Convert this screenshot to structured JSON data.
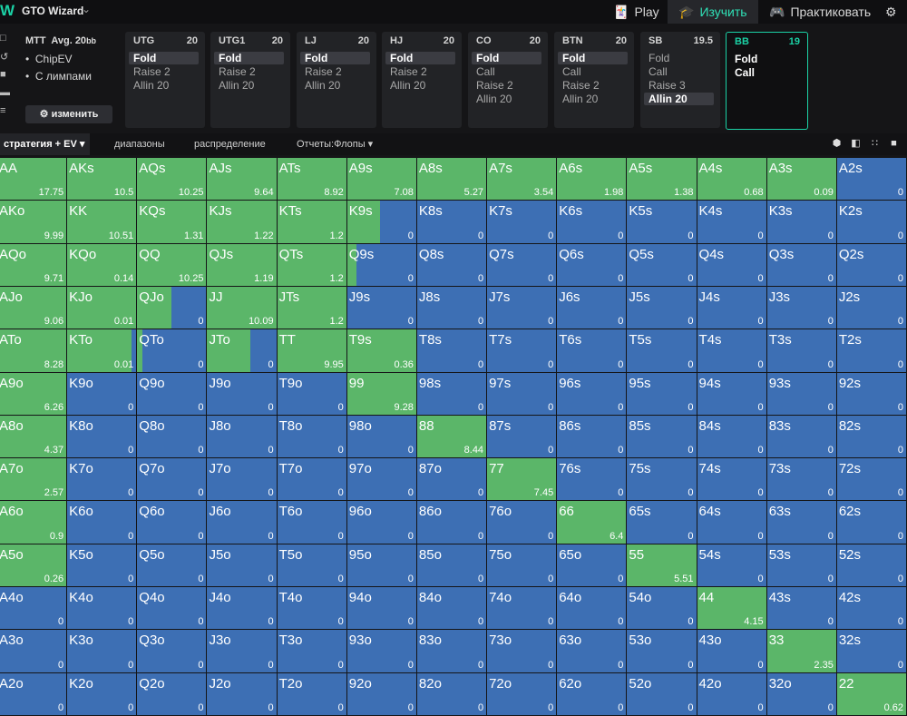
{
  "app": {
    "title": "GTO Wizard"
  },
  "nav": {
    "play": "Play",
    "study": "Изучить",
    "practice": "Практиковать"
  },
  "info": {
    "format": "MTT",
    "avg": "Avg. 20",
    "avg_unit": "bb",
    "option1": "ChipEV",
    "option2": "С лимпами",
    "change_button": "изменить"
  },
  "positions": [
    {
      "name": "UTG",
      "stack": "20",
      "actions": [
        "Fold",
        "Raise 2",
        "Allin 20"
      ],
      "selected": 0
    },
    {
      "name": "UTG1",
      "stack": "20",
      "actions": [
        "Fold",
        "Raise 2",
        "Allin 20"
      ],
      "selected": 0
    },
    {
      "name": "LJ",
      "stack": "20",
      "actions": [
        "Fold",
        "Raise 2",
        "Allin 20"
      ],
      "selected": 0
    },
    {
      "name": "HJ",
      "stack": "20",
      "actions": [
        "Fold",
        "Raise 2",
        "Allin 20"
      ],
      "selected": 0
    },
    {
      "name": "CO",
      "stack": "20",
      "actions": [
        "Fold",
        "Call",
        "Raise 2",
        "Allin 20"
      ],
      "selected": 0
    },
    {
      "name": "BTN",
      "stack": "20",
      "actions": [
        "Fold",
        "Call",
        "Raise 2",
        "Allin 20"
      ],
      "selected": 0
    },
    {
      "name": "SB",
      "stack": "19.5",
      "actions": [
        "Fold",
        "Call",
        "Raise 3",
        "Allin 20"
      ],
      "selected": 3
    },
    {
      "name": "BB",
      "stack": "19",
      "actions": [
        "Fold",
        "Call"
      ],
      "selected": -1,
      "active": true
    }
  ],
  "tabs": [
    "стратегия + EV",
    "диапазоны",
    "распределение",
    "Отчеты:Флопы"
  ],
  "colors": {
    "call": "#5bb669",
    "fold": "#3d6fb4",
    "accent": "#1bd1a5"
  },
  "matrix": [
    [
      [
        "AA",
        1,
        "17.75"
      ],
      [
        "AKs",
        1,
        "10.5"
      ],
      [
        "AQs",
        1,
        "10.25"
      ],
      [
        "AJs",
        1,
        "9.64"
      ],
      [
        "ATs",
        1,
        "8.92"
      ],
      [
        "A9s",
        1,
        "7.08"
      ],
      [
        "A8s",
        1,
        "5.27"
      ],
      [
        "A7s",
        1,
        "3.54"
      ],
      [
        "A6s",
        1,
        "1.98"
      ],
      [
        "A5s",
        1,
        "1.38"
      ],
      [
        "A4s",
        1,
        "0.68"
      ],
      [
        "A3s",
        1,
        "0.09"
      ],
      [
        "A2s",
        0,
        "0"
      ]
    ],
    [
      [
        "AKo",
        1,
        "9.99"
      ],
      [
        "KK",
        1,
        "10.51"
      ],
      [
        "KQs",
        1,
        "1.31"
      ],
      [
        "KJs",
        1,
        "1.22"
      ],
      [
        "KTs",
        1,
        "1.2"
      ],
      [
        "K9s",
        0.48,
        "0"
      ],
      [
        "K8s",
        0,
        "0"
      ],
      [
        "K7s",
        0,
        "0"
      ],
      [
        "K6s",
        0,
        "0"
      ],
      [
        "K5s",
        0,
        "0"
      ],
      [
        "K4s",
        0,
        "0"
      ],
      [
        "K3s",
        0,
        "0"
      ],
      [
        "K2s",
        0,
        "0"
      ]
    ],
    [
      [
        "AQo",
        1,
        "9.71"
      ],
      [
        "KQo",
        1,
        "0.14"
      ],
      [
        "QQ",
        1,
        "10.25"
      ],
      [
        "QJs",
        1,
        "1.19"
      ],
      [
        "QTs",
        1,
        "1.2"
      ],
      [
        "Q9s",
        0.13,
        "0"
      ],
      [
        "Q8s",
        0,
        "0"
      ],
      [
        "Q7s",
        0,
        "0"
      ],
      [
        "Q6s",
        0,
        "0"
      ],
      [
        "Q5s",
        0,
        "0"
      ],
      [
        "Q4s",
        0,
        "0"
      ],
      [
        "Q3s",
        0,
        "0"
      ],
      [
        "Q2s",
        0,
        "0"
      ]
    ],
    [
      [
        "AJo",
        1,
        "9.06"
      ],
      [
        "KJo",
        1,
        "0.01"
      ],
      [
        "QJo",
        0.49,
        "0"
      ],
      [
        "JJ",
        1,
        "10.09"
      ],
      [
        "JTs",
        1,
        "1.2"
      ],
      [
        "J9s",
        0,
        "0"
      ],
      [
        "J8s",
        0,
        "0"
      ],
      [
        "J7s",
        0,
        "0"
      ],
      [
        "J6s",
        0,
        "0"
      ],
      [
        "J5s",
        0,
        "0"
      ],
      [
        "J4s",
        0,
        "0"
      ],
      [
        "J3s",
        0,
        "0"
      ],
      [
        "J2s",
        0,
        "0"
      ]
    ],
    [
      [
        "ATo",
        1,
        "8.28"
      ],
      [
        "KTo",
        0.93,
        "0.01"
      ],
      [
        "QTo",
        0.07,
        "0"
      ],
      [
        "JTo",
        0.62,
        "0"
      ],
      [
        "TT",
        1,
        "9.95"
      ],
      [
        "T9s",
        1,
        "0.36"
      ],
      [
        "T8s",
        0,
        "0"
      ],
      [
        "T7s",
        0,
        "0"
      ],
      [
        "T6s",
        0,
        "0"
      ],
      [
        "T5s",
        0,
        "0"
      ],
      [
        "T4s",
        0,
        "0"
      ],
      [
        "T3s",
        0,
        "0"
      ],
      [
        "T2s",
        0,
        "0"
      ]
    ],
    [
      [
        "A9o",
        1,
        "6.26"
      ],
      [
        "K9o",
        0,
        "0"
      ],
      [
        "Q9o",
        0,
        "0"
      ],
      [
        "J9o",
        0,
        "0"
      ],
      [
        "T9o",
        0,
        "0"
      ],
      [
        "99",
        1,
        "9.28"
      ],
      [
        "98s",
        0,
        "0"
      ],
      [
        "97s",
        0,
        "0"
      ],
      [
        "96s",
        0,
        "0"
      ],
      [
        "95s",
        0,
        "0"
      ],
      [
        "94s",
        0,
        "0"
      ],
      [
        "93s",
        0,
        "0"
      ],
      [
        "92s",
        0,
        "0"
      ]
    ],
    [
      [
        "A8o",
        1,
        "4.37"
      ],
      [
        "K8o",
        0,
        "0"
      ],
      [
        "Q8o",
        0,
        "0"
      ],
      [
        "J8o",
        0,
        "0"
      ],
      [
        "T8o",
        0,
        "0"
      ],
      [
        "98o",
        0,
        "0"
      ],
      [
        "88",
        1,
        "8.44"
      ],
      [
        "87s",
        0,
        "0"
      ],
      [
        "86s",
        0,
        "0"
      ],
      [
        "85s",
        0,
        "0"
      ],
      [
        "84s",
        0,
        "0"
      ],
      [
        "83s",
        0,
        "0"
      ],
      [
        "82s",
        0,
        "0"
      ]
    ],
    [
      [
        "A7o",
        1,
        "2.57"
      ],
      [
        "K7o",
        0,
        "0"
      ],
      [
        "Q7o",
        0,
        "0"
      ],
      [
        "J7o",
        0,
        "0"
      ],
      [
        "T7o",
        0,
        "0"
      ],
      [
        "97o",
        0,
        "0"
      ],
      [
        "87o",
        0,
        "0"
      ],
      [
        "77",
        1,
        "7.45"
      ],
      [
        "76s",
        0,
        "0"
      ],
      [
        "75s",
        0,
        "0"
      ],
      [
        "74s",
        0,
        "0"
      ],
      [
        "73s",
        0,
        "0"
      ],
      [
        "72s",
        0,
        "0"
      ]
    ],
    [
      [
        "A6o",
        1,
        "0.9"
      ],
      [
        "K6o",
        0,
        "0"
      ],
      [
        "Q6o",
        0,
        "0"
      ],
      [
        "J6o",
        0,
        "0"
      ],
      [
        "T6o",
        0,
        "0"
      ],
      [
        "96o",
        0,
        "0"
      ],
      [
        "86o",
        0,
        "0"
      ],
      [
        "76o",
        0,
        "0"
      ],
      [
        "66",
        1,
        "6.4"
      ],
      [
        "65s",
        0,
        "0"
      ],
      [
        "64s",
        0,
        "0"
      ],
      [
        "63s",
        0,
        "0"
      ],
      [
        "62s",
        0,
        "0"
      ]
    ],
    [
      [
        "A5o",
        1,
        "0.26"
      ],
      [
        "K5o",
        0,
        "0"
      ],
      [
        "Q5o",
        0,
        "0"
      ],
      [
        "J5o",
        0,
        "0"
      ],
      [
        "T5o",
        0,
        "0"
      ],
      [
        "95o",
        0,
        "0"
      ],
      [
        "85o",
        0,
        "0"
      ],
      [
        "75o",
        0,
        "0"
      ],
      [
        "65o",
        0,
        "0"
      ],
      [
        "55",
        1,
        "5.51"
      ],
      [
        "54s",
        0,
        "0"
      ],
      [
        "53s",
        0,
        "0"
      ],
      [
        "52s",
        0,
        "0"
      ]
    ],
    [
      [
        "A4o",
        0,
        "0"
      ],
      [
        "K4o",
        0,
        "0"
      ],
      [
        "Q4o",
        0,
        "0"
      ],
      [
        "J4o",
        0,
        "0"
      ],
      [
        "T4o",
        0,
        "0"
      ],
      [
        "94o",
        0,
        "0"
      ],
      [
        "84o",
        0,
        "0"
      ],
      [
        "74o",
        0,
        "0"
      ],
      [
        "64o",
        0,
        "0"
      ],
      [
        "54o",
        0,
        "0"
      ],
      [
        "44",
        1,
        "4.15"
      ],
      [
        "43s",
        0,
        "0"
      ],
      [
        "42s",
        0,
        "0"
      ]
    ],
    [
      [
        "A3o",
        0,
        "0"
      ],
      [
        "K3o",
        0,
        "0"
      ],
      [
        "Q3o",
        0,
        "0"
      ],
      [
        "J3o",
        0,
        "0"
      ],
      [
        "T3o",
        0,
        "0"
      ],
      [
        "93o",
        0,
        "0"
      ],
      [
        "83o",
        0,
        "0"
      ],
      [
        "73o",
        0,
        "0"
      ],
      [
        "63o",
        0,
        "0"
      ],
      [
        "53o",
        0,
        "0"
      ],
      [
        "43o",
        0,
        "0"
      ],
      [
        "33",
        1,
        "2.35"
      ],
      [
        "32s",
        0,
        "0"
      ]
    ],
    [
      [
        "A2o",
        0,
        "0"
      ],
      [
        "K2o",
        0,
        "0"
      ],
      [
        "Q2o",
        0,
        "0"
      ],
      [
        "J2o",
        0,
        "0"
      ],
      [
        "T2o",
        0,
        "0"
      ],
      [
        "92o",
        0,
        "0"
      ],
      [
        "82o",
        0,
        "0"
      ],
      [
        "72o",
        0,
        "0"
      ],
      [
        "62o",
        0,
        "0"
      ],
      [
        "52o",
        0,
        "0"
      ],
      [
        "42o",
        0,
        "0"
      ],
      [
        "32o",
        0,
        "0"
      ],
      [
        "22",
        1,
        "0.62"
      ]
    ]
  ]
}
